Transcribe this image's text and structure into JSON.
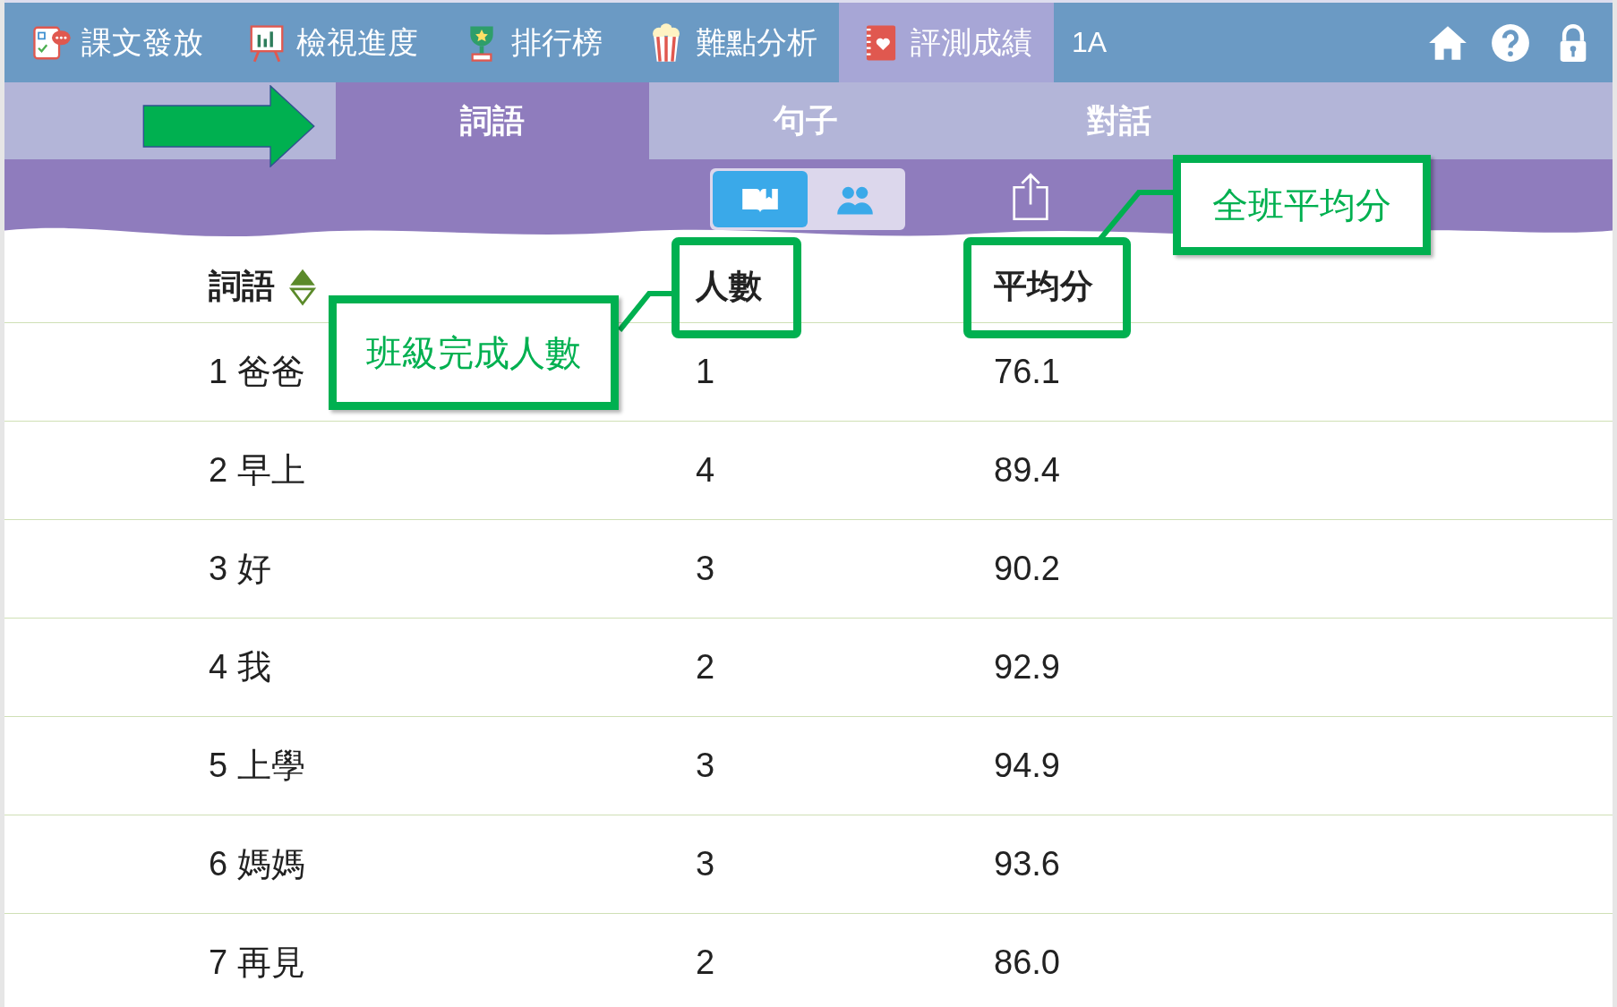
{
  "nav": {
    "items": [
      {
        "label": "課文發放",
        "kind": "assign",
        "selected": false
      },
      {
        "label": "檢視進度",
        "kind": "progress",
        "selected": false
      },
      {
        "label": "排行榜",
        "kind": "ranking",
        "selected": false
      },
      {
        "label": "難點分析",
        "kind": "analysis",
        "selected": false
      },
      {
        "label": "評測成績",
        "kind": "scores",
        "selected": true
      }
    ],
    "class_label": "1A"
  },
  "subtabs": [
    {
      "label": "詞語",
      "selected": true
    },
    {
      "label": "句子",
      "selected": false
    },
    {
      "label": "對話",
      "selected": false
    }
  ],
  "view_toggle": [
    {
      "kind": "book",
      "selected": true
    },
    {
      "kind": "people",
      "selected": false
    }
  ],
  "table": {
    "columns": [
      {
        "label": "詞語",
        "sortable": true
      },
      {
        "label": "人數",
        "sortable": false
      },
      {
        "label": "平均分",
        "sortable": false
      }
    ],
    "rows": [
      {
        "word": "1 爸爸",
        "count": "1",
        "average": "76.1"
      },
      {
        "word": "2 早上",
        "count": "4",
        "average": "89.4"
      },
      {
        "word": "3 好",
        "count": "3",
        "average": "90.2"
      },
      {
        "word": "4 我",
        "count": "2",
        "average": "92.9"
      },
      {
        "word": "5 上學",
        "count": "3",
        "average": "94.9"
      },
      {
        "word": "6 媽媽",
        "count": "3",
        "average": "93.6"
      },
      {
        "word": "7 再見",
        "count": "2",
        "average": "86.0"
      }
    ]
  },
  "annotations": {
    "callouts": [
      {
        "text": "班級完成人數"
      },
      {
        "text": "全班平均分"
      }
    ]
  }
}
